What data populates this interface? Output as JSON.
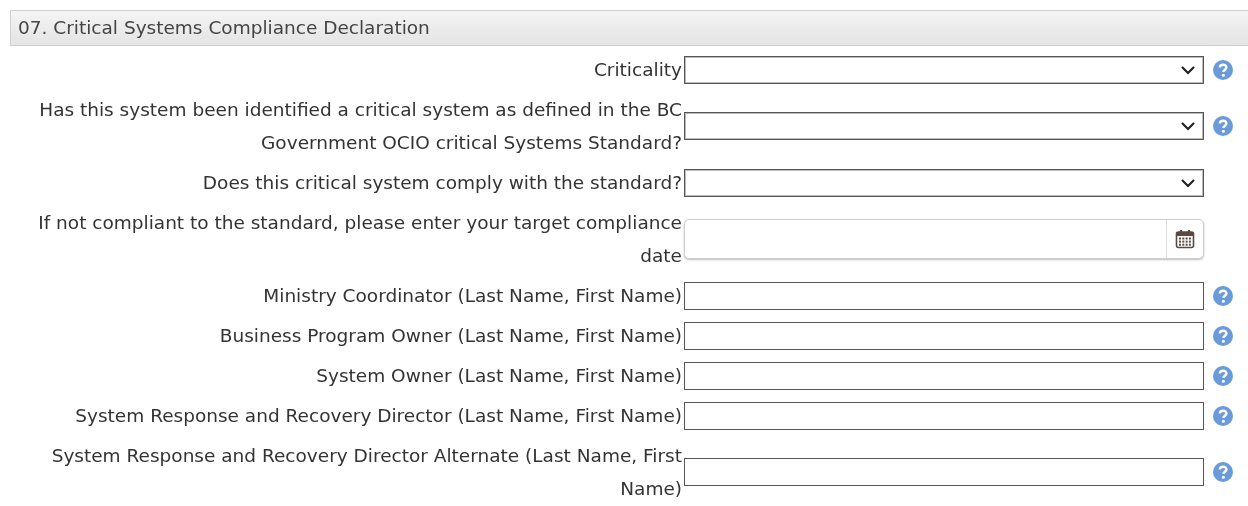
{
  "section": {
    "title": "07. Critical Systems Compliance Declaration"
  },
  "fields": [
    {
      "label": "Criticality",
      "kind": "select",
      "help": true
    },
    {
      "label": "Has this system been identified a critical system as defined in the BC Government OCIO critical Systems Standard?",
      "kind": "select",
      "help": true
    },
    {
      "label": "Does this critical system comply with the standard?",
      "kind": "select",
      "help": false
    },
    {
      "label": "If not compliant to the standard, please enter your target compliance date",
      "kind": "date",
      "help": false
    },
    {
      "label": "Ministry Coordinator (Last Name, First Name)",
      "kind": "text",
      "help": true
    },
    {
      "label": "Business Program Owner (Last Name, First Name)",
      "kind": "text",
      "help": true
    },
    {
      "label": "System Owner (Last Name, First Name)",
      "kind": "text",
      "help": true
    },
    {
      "label": "System Response and Recovery Director (Last Name, First Name)",
      "kind": "text",
      "help": true
    },
    {
      "label": "System Response and Recovery Director Alternate (Last Name, First Name)",
      "kind": "text",
      "help": true
    }
  ]
}
